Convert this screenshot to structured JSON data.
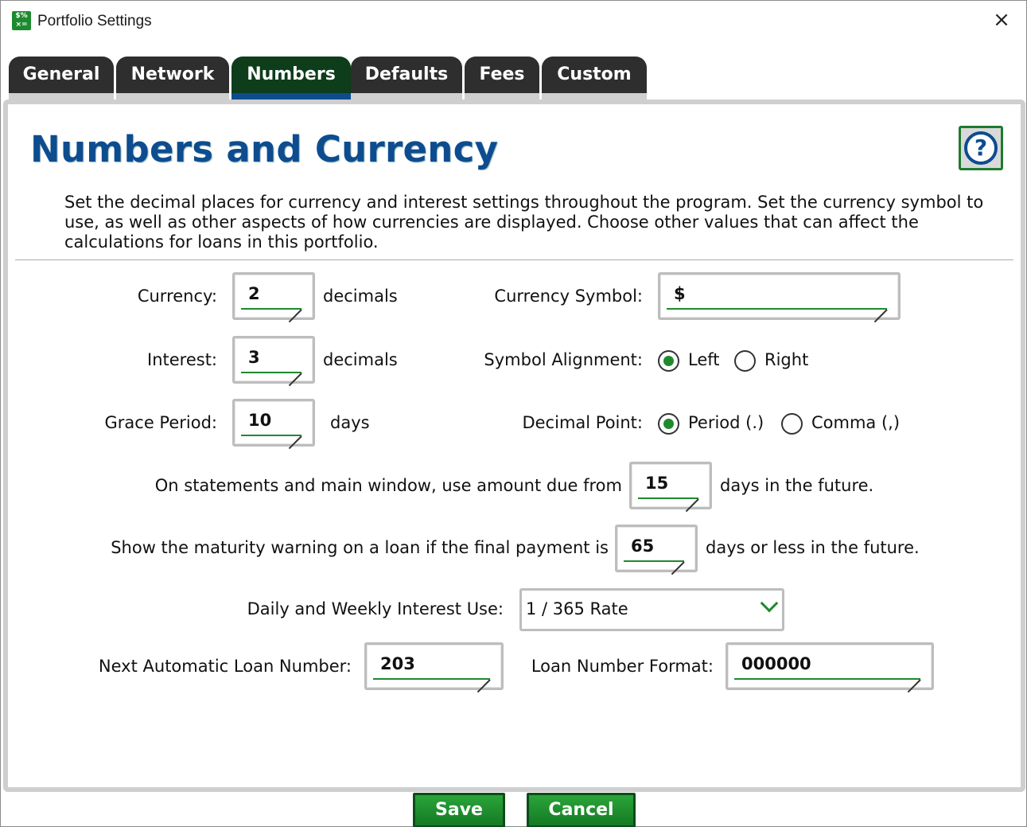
{
  "window": {
    "title": "Portfolio Settings",
    "app_icon_text": "$%\n×="
  },
  "tabs": [
    {
      "label": "General",
      "active": false
    },
    {
      "label": "Network",
      "active": false
    },
    {
      "label": "Numbers",
      "active": true
    },
    {
      "label": "Defaults",
      "active": false
    },
    {
      "label": "Fees",
      "active": false
    },
    {
      "label": "Custom",
      "active": false
    }
  ],
  "heading": "Numbers and Currency",
  "help_symbol": "?",
  "description": "Set the decimal places for currency and interest settings throughout the program. Set the currency symbol to use, as well as other aspects of how currencies are displayed. Choose other values that can affect the calculations for loans in this portfolio.",
  "currency": {
    "label": "Currency:",
    "value": "2",
    "unit": "decimals"
  },
  "interest": {
    "label": "Interest:",
    "value": "3",
    "unit": "decimals"
  },
  "grace_period": {
    "label": "Grace Period:",
    "value": "10",
    "unit": "days"
  },
  "currency_symbol": {
    "label": "Currency Symbol:",
    "value": "$"
  },
  "symbol_alignment": {
    "label": "Symbol Alignment:",
    "options": [
      {
        "label": "Left",
        "selected": true
      },
      {
        "label": "Right",
        "selected": false
      }
    ]
  },
  "decimal_point": {
    "label": "Decimal Point:",
    "options": [
      {
        "label": "Period (.)",
        "selected": true
      },
      {
        "label": "Comma (,)",
        "selected": false
      }
    ]
  },
  "amount_due": {
    "prefix": "On statements and main window, use amount due from",
    "value": "15",
    "suffix": "days in the future."
  },
  "maturity_warning": {
    "prefix": "Show the maturity warning on a loan if the final payment is",
    "value": "65",
    "suffix": "days or less in the future."
  },
  "daily_weekly_interest": {
    "label": "Daily and Weekly Interest Use:",
    "selected": "1 / 365 Rate"
  },
  "next_loan_number": {
    "label": "Next Automatic Loan Number:",
    "value": "203"
  },
  "loan_number_format": {
    "label": "Loan Number Format:",
    "value": "000000"
  },
  "buttons": {
    "save": "Save",
    "cancel": "Cancel"
  },
  "colors": {
    "accent_green": "#1e8a2e",
    "brand_blue": "#0d4c8f",
    "tab_dark": "#2e2e2e"
  }
}
